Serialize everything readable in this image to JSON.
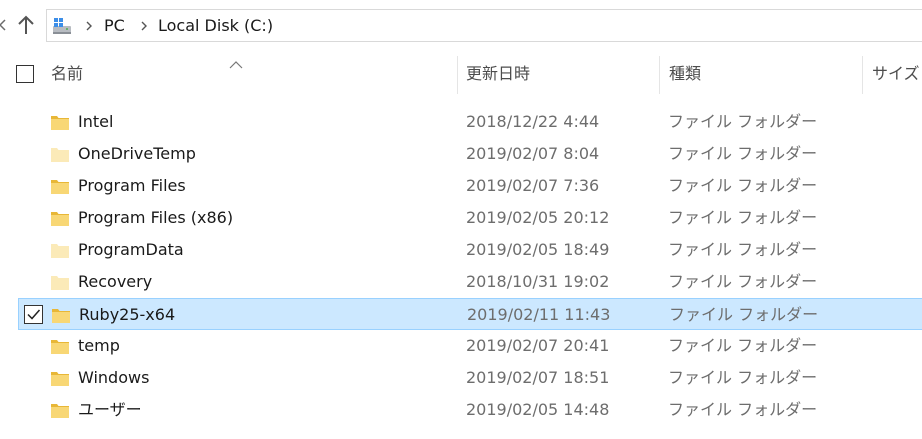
{
  "address_bar": {
    "breadcrumbs": [
      "PC",
      "Local Disk (C:)"
    ]
  },
  "icons": {
    "back": "back-arrow-icon",
    "up": "up-arrow-icon",
    "location": "pc-icon",
    "folder": "folder-icon"
  },
  "columns": {
    "name": "名前",
    "date": "更新日時",
    "type": "種類",
    "size": "サイズ"
  },
  "sort": {
    "column": "name",
    "direction": "ascending"
  },
  "files": [
    {
      "name": "Intel",
      "date": "2018/12/22 4:44",
      "type": "ファイル フォルダー",
      "hidden": false,
      "selected": false
    },
    {
      "name": "OneDriveTemp",
      "date": "2019/02/07 8:04",
      "type": "ファイル フォルダー",
      "hidden": true,
      "selected": false
    },
    {
      "name": "Program Files",
      "date": "2019/02/07 7:36",
      "type": "ファイル フォルダー",
      "hidden": false,
      "selected": false
    },
    {
      "name": "Program Files (x86)",
      "date": "2019/02/05 20:12",
      "type": "ファイル フォルダー",
      "hidden": false,
      "selected": false
    },
    {
      "name": "ProgramData",
      "date": "2019/02/05 18:49",
      "type": "ファイル フォルダー",
      "hidden": true,
      "selected": false
    },
    {
      "name": "Recovery",
      "date": "2018/10/31 19:02",
      "type": "ファイル フォルダー",
      "hidden": true,
      "selected": false
    },
    {
      "name": "Ruby25-x64",
      "date": "2019/02/11 11:43",
      "type": "ファイル フォルダー",
      "hidden": false,
      "selected": true
    },
    {
      "name": "temp",
      "date": "2019/02/07 20:41",
      "type": "ファイル フォルダー",
      "hidden": false,
      "selected": false
    },
    {
      "name": "Windows",
      "date": "2019/02/07 18:51",
      "type": "ファイル フォルダー",
      "hidden": false,
      "selected": false
    },
    {
      "name": "ユーザー",
      "date": "2019/02/05 14:48",
      "type": "ファイル フォルダー",
      "hidden": false,
      "selected": false
    }
  ],
  "colors": {
    "selection_bg": "#cce8ff",
    "selection_border": "#99d1ff",
    "folder": "#f8d775",
    "folder_dark": "#e8b737",
    "folder_hidden": "#fbeab8"
  }
}
